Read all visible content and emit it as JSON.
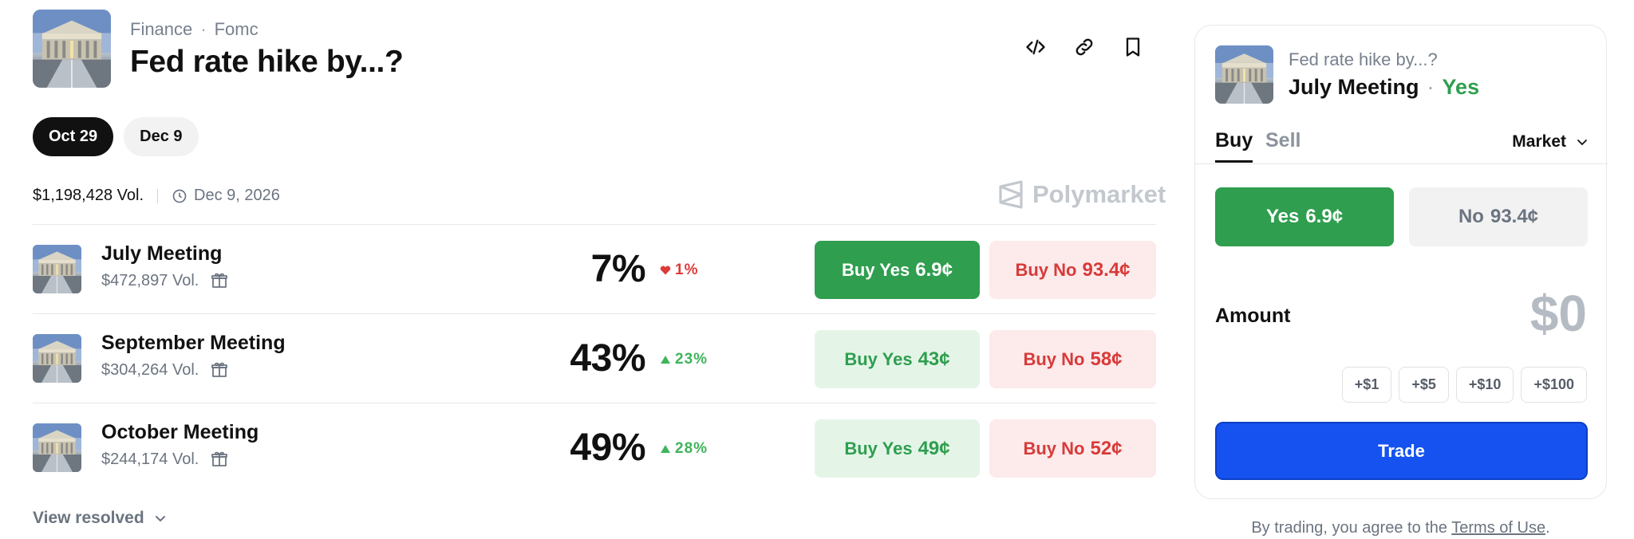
{
  "header": {
    "thumbnail_icon": "federal-reserve-building-image",
    "breadcrumb": {
      "category": "Finance",
      "separator": "·",
      "tag": "Fomc"
    },
    "title": "Fed rate hike by...?",
    "actions": [
      "embed-code-icon",
      "link-icon",
      "bookmark-icon"
    ]
  },
  "date_tabs": [
    {
      "label": "Oct 29",
      "active": true
    },
    {
      "label": "Dec 9",
      "active": false
    }
  ],
  "meta": {
    "volume": "$1,198,428 Vol.",
    "end_date": "Dec 9, 2026",
    "brand": "Polymarket"
  },
  "markets": [
    {
      "name": "July Meeting",
      "volume": "$472,897 Vol.",
      "percent": "7%",
      "change": "1%",
      "direction": "down",
      "yes_label": "Buy Yes",
      "yes_price": "6.9¢",
      "no_label": "Buy No",
      "no_price": "93.4¢",
      "selected": true
    },
    {
      "name": "September Meeting",
      "volume": "$304,264 Vol.",
      "percent": "43%",
      "change": "23%",
      "direction": "up",
      "yes_label": "Buy Yes",
      "yes_price": "43¢",
      "no_label": "Buy No",
      "no_price": "58¢",
      "selected": false
    },
    {
      "name": "October Meeting",
      "volume": "$244,174 Vol.",
      "percent": "49%",
      "change": "28%",
      "direction": "up",
      "yes_label": "Buy Yes",
      "yes_price": "49¢",
      "no_label": "Buy No",
      "no_price": "52¢",
      "selected": false
    }
  ],
  "view_resolved": "View resolved",
  "trade_panel": {
    "question": "Fed rate hike by...?",
    "outcome": "July Meeting",
    "separator": "·",
    "side": "Yes",
    "tabs": {
      "buy": "Buy",
      "sell": "Sell"
    },
    "order_type": "Market",
    "yes_option": {
      "label": "Yes",
      "price": "6.9¢"
    },
    "no_option": {
      "label": "No",
      "price": "93.4¢"
    },
    "amount_label": "Amount",
    "amount_value": "$0",
    "quick_amounts": [
      "+$1",
      "+$5",
      "+$10",
      "+$100"
    ],
    "trade_button": "Trade"
  },
  "terms": {
    "prefix": "By trading, you agree to the",
    "link": "Terms of Use",
    "suffix": "."
  },
  "colors": {
    "green": "#2f9e4f",
    "red": "#d83a3a",
    "blue": "#1552f0",
    "dark": "#111111"
  }
}
